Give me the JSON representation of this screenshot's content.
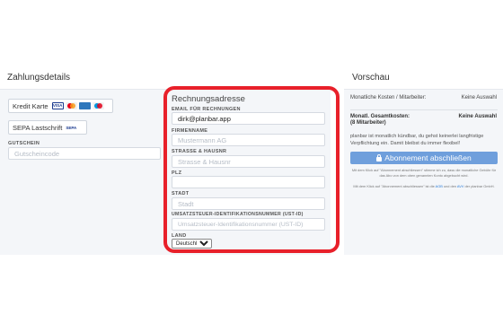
{
  "zahlungsdetails": {
    "title": "Zahlungsdetails",
    "credit_card_label": "Kredit Karte",
    "card_logos": [
      "visa-logo",
      "mastercard-logo",
      "amex-logo",
      "maestro-logo"
    ],
    "sepa_label": "SEPA Lastschrift",
    "sepa_logo": "SEPA",
    "visa_text": "VISA",
    "gutschein_label": "GUTSCHEIN",
    "gutschein_placeholder": "Gutscheincode"
  },
  "rechnungsadresse": {
    "title": "Rechnungsadresse",
    "email_label": "EMAIL FÜR RECHNUNGEN",
    "email_value": "dirk@planbar.app",
    "firma_label": "FIRMENNAME",
    "firma_placeholder": "Mustermann AG",
    "strasse_label": "STRASSE & HAUSNR",
    "strasse_placeholder": "Strasse & Hausnr",
    "plz_label": "PLZ",
    "plz_value": "",
    "stadt_label": "STADT",
    "stadt_placeholder": "Stadt",
    "ust_label": "UMSATZSTEUER-IDENTIFIKATIONSNUMMER (UST-ID)",
    "ust_placeholder": "Umsatzsteuer-Identifikationsnummer (UST-ID)",
    "land_label": "LAND",
    "land_selected": "Deutschland"
  },
  "vorschau": {
    "title": "Vorschau",
    "monthly_label": "Monatliche Kosten / Mitarbeiter:",
    "monthly_value": "Keine Auswahl",
    "total_label": "Monatl. Gesamtkosten:",
    "total_sub": "(8 Mitarbeiter)",
    "total_value": "Keine Auswahl",
    "description": "planbar ist monatlich kündbar, du gehst keinerlei langfristige Verpflichtung ein. Damit bleibst du immer flexibel!",
    "button_label": "Abonnement abschließen",
    "fine_print_1": "Mit dem Klick auf \"Abonnement abschliessen\" stimme ich zu, dass die monatliche Gebühr für das Abo von dem oben genannten Konto abgebucht wird.",
    "fine_print_2_pre": "Mit dem Klick auf \"Abonnement abschliessen\" ist die",
    "agb_link": "AGB",
    "fine_print_2_mid": "und den",
    "avv_link": "AVV",
    "fine_print_2_post": "der planbar GmbH."
  },
  "colors": {
    "highlight_border": "#e8202a",
    "primary_button": "#6f9fdc",
    "panel_bg": "#f4f6f9"
  }
}
